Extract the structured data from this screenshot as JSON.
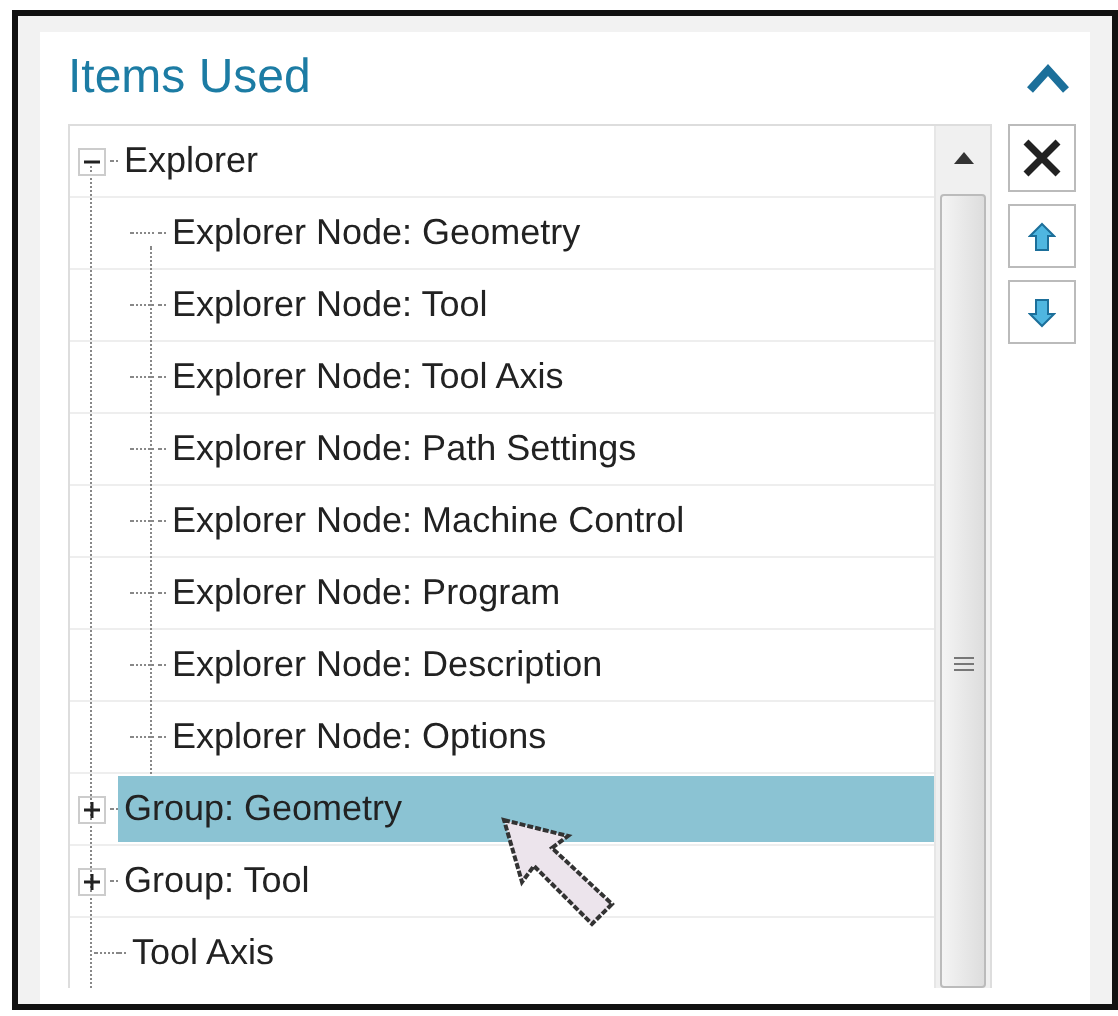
{
  "panel": {
    "title": "Items Used",
    "expanded": true
  },
  "tree": [
    {
      "label": "Explorer",
      "kind": "node",
      "expanded": true,
      "selected": false,
      "children": [
        {
          "label": "Explorer Node: Geometry",
          "kind": "leaf",
          "selected": false
        },
        {
          "label": "Explorer Node: Tool",
          "kind": "leaf",
          "selected": false
        },
        {
          "label": "Explorer Node: Tool Axis",
          "kind": "leaf",
          "selected": false
        },
        {
          "label": "Explorer Node: Path Settings",
          "kind": "leaf",
          "selected": false
        },
        {
          "label": "Explorer Node: Machine Control",
          "kind": "leaf",
          "selected": false
        },
        {
          "label": "Explorer Node: Program",
          "kind": "leaf",
          "selected": false
        },
        {
          "label": "Explorer Node: Description",
          "kind": "leaf",
          "selected": false
        },
        {
          "label": "Explorer Node: Options",
          "kind": "leaf",
          "selected": false
        }
      ]
    },
    {
      "label": "Group: Geometry",
      "kind": "node",
      "expanded": false,
      "selected": true
    },
    {
      "label": "Group: Tool",
      "kind": "node",
      "expanded": false,
      "selected": false
    },
    {
      "label": "Tool Axis",
      "kind": "leaf",
      "selected": false
    }
  ]
}
